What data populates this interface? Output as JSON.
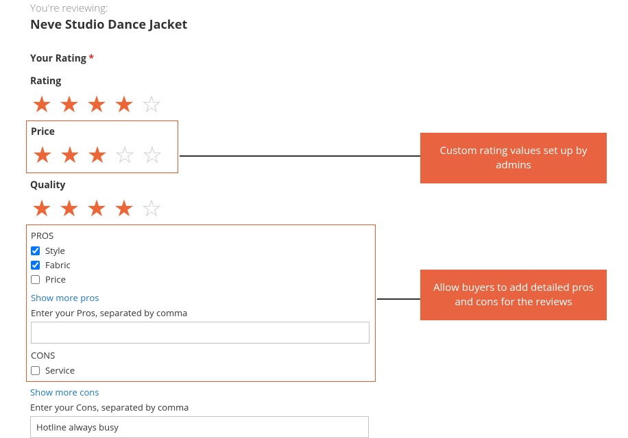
{
  "colors": {
    "accent": "#ec6737",
    "callout_bg": "#e8633f",
    "link": "#1979c3",
    "border_hl": "#e55a2b"
  },
  "intro": {
    "prefix": "You're reviewing:",
    "product": "Neve Studio Dance Jacket"
  },
  "section": {
    "your_rating": "Your Rating",
    "required_marker": "*"
  },
  "ratings": {
    "rating": {
      "label": "Rating",
      "value": 4,
      "max": 5
    },
    "price": {
      "label": "Price",
      "value": 3,
      "max": 5
    },
    "quality": {
      "label": "Quality",
      "value": 4,
      "max": 5
    }
  },
  "pros": {
    "heading": "PROS",
    "items": [
      {
        "label": "Style",
        "checked": true
      },
      {
        "label": "Fabric",
        "checked": true
      },
      {
        "label": "Price",
        "checked": false
      }
    ],
    "more_link": "Show more pros",
    "helper": "Enter your Pros, separated by comma",
    "input_value": ""
  },
  "cons": {
    "heading": "CONS",
    "items": [
      {
        "label": "Service",
        "checked": false
      }
    ],
    "more_link": "Show more cons",
    "helper": "Enter your Cons, separated by comma",
    "input_value": "Hotline always busy"
  },
  "callouts": {
    "rating_values": "Custom rating values set up by admins",
    "pros_cons": "Allow buyers to add detailed pros and cons for the reviews"
  }
}
